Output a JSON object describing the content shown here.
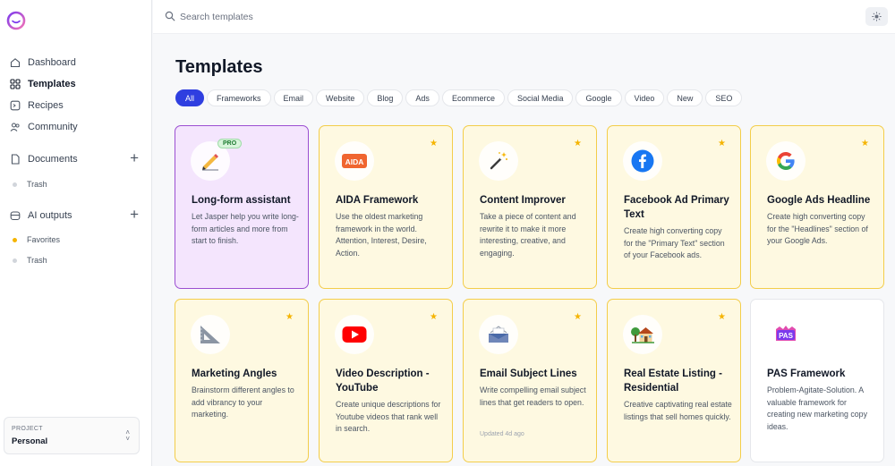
{
  "sidebar": {
    "nav": [
      {
        "label": "Dashboard",
        "icon": "home-icon"
      },
      {
        "label": "Templates",
        "icon": "grid-icon",
        "active": true
      },
      {
        "label": "Recipes",
        "icon": "recipe-icon"
      },
      {
        "label": "Community",
        "icon": "users-icon"
      }
    ],
    "documents": {
      "label": "Documents",
      "trash": "Trash"
    },
    "ai_outputs": {
      "label": "AI outputs",
      "favorites": "Favorites",
      "trash": "Trash"
    },
    "project": {
      "label": "PROJECT",
      "value": "Personal"
    }
  },
  "search": {
    "placeholder": "Search templates"
  },
  "page": {
    "title": "Templates"
  },
  "tabs": [
    "All",
    "Frameworks",
    "Email",
    "Website",
    "Blog",
    "Ads",
    "Ecommerce",
    "Social Media",
    "Google",
    "Video",
    "New",
    "SEO"
  ],
  "cards": [
    {
      "title": "Long-form assistant",
      "desc": "Let Jasper help you write long-form articles and more from start to finish.",
      "icon": "writing-hand-icon",
      "badge": "PRO",
      "style": "purple",
      "starred": false
    },
    {
      "title": "AIDA Framework",
      "desc": "Use the oldest marketing framework in the world. Attention, Interest, Desire, Action.",
      "icon": "aida-icon",
      "icon_text": "AIDA",
      "style": "yellow",
      "starred": true
    },
    {
      "title": "Content Improver",
      "desc": "Take a piece of content and rewrite it to make it more interesting, creative, and engaging.",
      "icon": "magic-wand-icon",
      "style": "yellow",
      "starred": true
    },
    {
      "title": "Facebook Ad Primary Text",
      "desc": "Create high converting copy for the \"Primary Text\" section of your Facebook ads.",
      "icon": "facebook-icon",
      "style": "yellow",
      "starred": true
    },
    {
      "title": "Google Ads Headline",
      "desc": "Create high converting copy for the \"Headlines\" section of your Google Ads.",
      "icon": "google-icon",
      "style": "yellow",
      "starred": true
    },
    {
      "title": "Marketing Angles",
      "desc": "Brainstorm different angles to add vibrancy to your marketing.",
      "icon": "triangle-ruler-icon",
      "style": "yellow",
      "starred": true
    },
    {
      "title": "Video Description - YouTube",
      "desc": "Create unique descriptions for Youtube videos that rank well in search.",
      "icon": "youtube-icon",
      "style": "yellow",
      "starred": true
    },
    {
      "title": "Email Subject Lines",
      "desc": "Write compelling email subject lines that get readers to open.",
      "icon": "inbox-icon",
      "updated": "Updated 4d ago",
      "style": "yellow",
      "starred": true
    },
    {
      "title": "Real Estate Listing - Residential",
      "desc": "Creative captivating real estate listings that sell homes quickly.",
      "icon": "house-icon",
      "style": "yellow",
      "starred": true
    },
    {
      "title": "PAS Framework",
      "desc": "Problem-Agitate-Solution. A valuable framework for creating new marketing copy ideas.",
      "icon": "pas-icon",
      "icon_text": "PAS",
      "style": "white",
      "starred": false
    }
  ],
  "colors": {
    "accent": "#2f3fe0",
    "star": "#f5b400",
    "card_yellow_bg": "#fef9e1",
    "card_yellow_border": "#f3cd4a",
    "card_purple_bg": "#f4e5fd",
    "card_purple_border": "#9b4fd1"
  }
}
